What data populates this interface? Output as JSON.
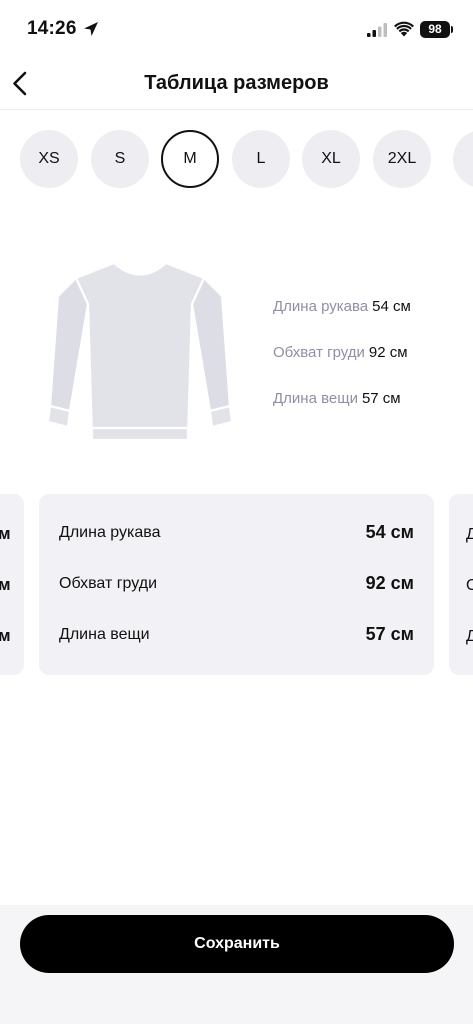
{
  "status_bar": {
    "time": "14:26",
    "battery": "98",
    "icons": [
      "location-arrow-icon",
      "cellular-signal-icon",
      "wifi-icon",
      "battery-icon"
    ]
  },
  "nav": {
    "title": "Таблица размеров",
    "back_icon": "chevron-left-icon"
  },
  "sizes": {
    "items": [
      "XS",
      "S",
      "M",
      "L",
      "XL",
      "2XL"
    ],
    "selected": "M"
  },
  "garment": {
    "icon": "sweater-icon",
    "measurements": [
      {
        "label": "Длина рукава",
        "value": "54 см"
      },
      {
        "label": "Обхват груди",
        "value": "92 см"
      },
      {
        "label": "Длина вещи",
        "value": "57 см"
      }
    ]
  },
  "cards": {
    "current": [
      {
        "label": "Длина рукава",
        "value": "54 см"
      },
      {
        "label": "Обхват груди",
        "value": "92 см"
      },
      {
        "label": "Длина вещи",
        "value": "57 см"
      }
    ],
    "prev_peek": [
      "м",
      "м",
      "м"
    ],
    "next_peek": [
      "Д",
      "О",
      "Д"
    ]
  },
  "footer": {
    "save_label": "Сохранить"
  },
  "colors": {
    "accent": "#000000",
    "chip_bg": "#eeeef2",
    "card_bg": "#f2f2f6",
    "muted_text": "#8f8fa5"
  }
}
